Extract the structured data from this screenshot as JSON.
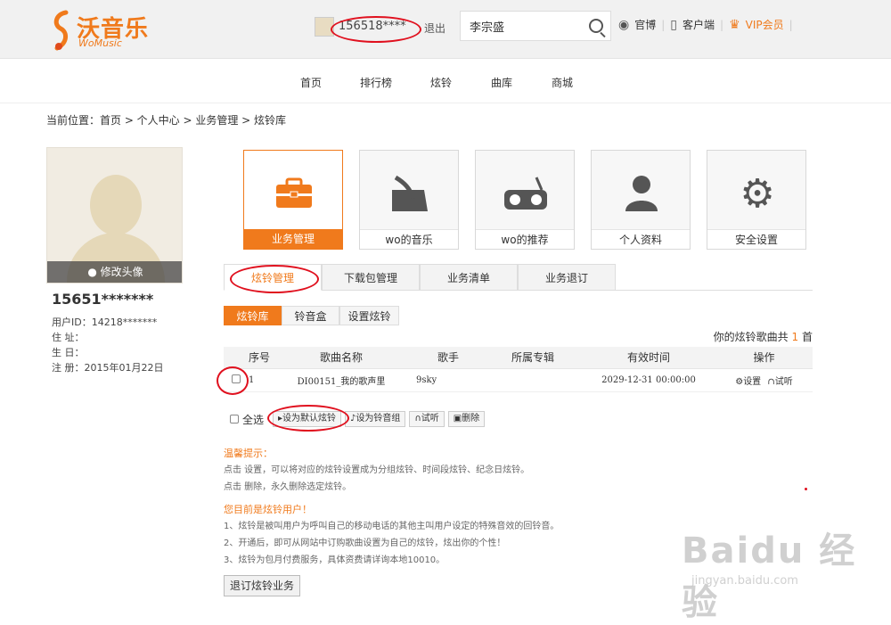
{
  "header": {
    "logo_text": "沃音乐",
    "logo_sub": "WoMusic",
    "user_id": "156518****",
    "logout": "退出",
    "search_value": "李宗盛",
    "links": [
      "官博",
      "客户端",
      "VIP会员"
    ]
  },
  "nav": {
    "items": [
      "首页",
      "排行榜",
      "炫铃",
      "曲库",
      "商城"
    ]
  },
  "breadcrumb": "当前位置：首页 > 个人中心 > 业务管理 > 炫铃库",
  "profile": {
    "edit_avatar": "修改头像",
    "name": "15651*******",
    "user_id": "用户ID：14218*******",
    "address": "住 址：",
    "birthday": "生 日：",
    "register": "注 册：2015年01月22日"
  },
  "tiles": [
    {
      "label": "业务管理",
      "icon": "briefcase-icon"
    },
    {
      "label": "wo的音乐",
      "icon": "music-folder-icon"
    },
    {
      "label": "wo的推荐",
      "icon": "radio-icon"
    },
    {
      "label": "个人资料",
      "icon": "person-icon"
    },
    {
      "label": "安全设置",
      "icon": "gear-icon"
    }
  ],
  "tabs": [
    "炫铃管理",
    "下载包管理",
    "业务清单",
    "业务退订"
  ],
  "subtabs": [
    "炫铃库",
    "铃音盒",
    "设置炫铃"
  ],
  "count": {
    "prefix": "你的炫铃歌曲共",
    "value": "1",
    "suffix": "首"
  },
  "table": {
    "headers": [
      "序号",
      "歌曲名称",
      "歌手",
      "所属专辑",
      "有效时间",
      "操作"
    ],
    "rows": [
      {
        "no": "1",
        "song": "DI00151_我的歌声里",
        "singer": "9sky",
        "album": "",
        "time": "2029-12-31 00:00:00",
        "set": "设置",
        "listen": "试听"
      }
    ]
  },
  "actions": {
    "select_all": "全选",
    "set_default": "设为默认炫铃",
    "set_group": "设为铃音组",
    "listen": "试听",
    "delete": "删除"
  },
  "tips": {
    "title1": "温馨提示：",
    "line1": "点击 设置，可以将对应的炫铃设置成为分组炫铃、时间段炫铃、纪念日炫铃。",
    "line2": "点击 删除，永久删除选定炫铃。",
    "title2": "您目前是炫铃用户！",
    "line3": "1、炫铃是被叫用户为呼叫自己的移动电话的其他主叫用户设定的特殊音效的回铃音。",
    "line4": "2、开通后，即可从网站中订购歌曲设置为自己的炫铃，炫出你的个性！",
    "line5": "3、炫铃为包月付费服务，具体资费请详询本地10010。"
  },
  "cancel_button": "退订炫铃业务",
  "watermark": {
    "text": "Baidu 经验",
    "sub": "jingyan.baidu.com"
  }
}
